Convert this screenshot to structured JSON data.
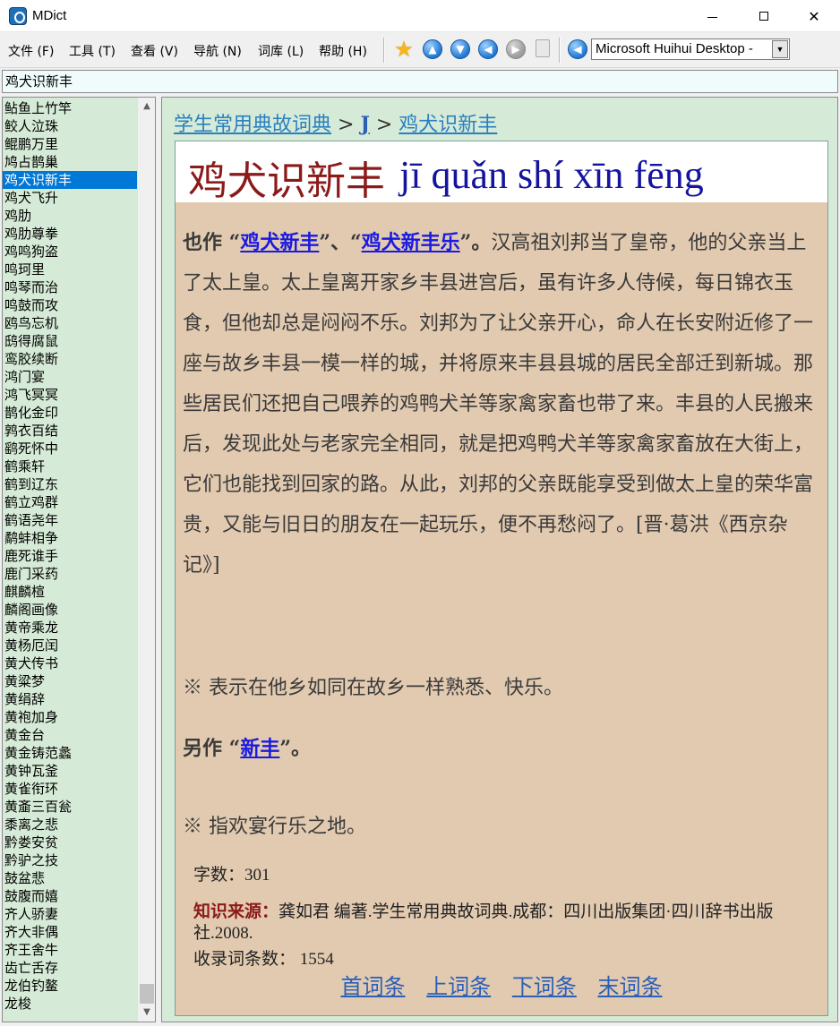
{
  "window": {
    "title": "MDict",
    "minimize_symbol": "",
    "close_symbol": "✕"
  },
  "menu": [
    {
      "label": "文件 (F)"
    },
    {
      "label": "工具 (T)"
    },
    {
      "label": "查看 (V)"
    },
    {
      "label": "导航 (N)"
    },
    {
      "label": "词库 (L)"
    },
    {
      "label": "帮助 (H)"
    }
  ],
  "toolbar": {
    "icons": [
      "star-icon",
      "arrow-up-icon",
      "arrow-down-icon",
      "arrow-left-icon",
      "arrow-right-icon",
      "clipboard-icon",
      "speaker-icon"
    ],
    "dictionary_selected": "Microsoft Huihui Desktop -"
  },
  "search": {
    "value": "鸡犬识新丰"
  },
  "wordlist": {
    "selected_index": 4,
    "items": [
      "鲇鱼上竹竿",
      "鲛人泣珠",
      "鲲鹏万里",
      "鸠占鹊巢",
      "鸡犬识新丰",
      "鸡犬飞升",
      "鸡肋",
      "鸡肋尊拳",
      "鸡鸣狗盗",
      "鸣珂里",
      "鸣琴而治",
      "鸣鼓而攻",
      "鸥鸟忘机",
      "鸱得腐鼠",
      "鸾胶续断",
      "鸿门宴",
      "鸿飞冥冥",
      "鹊化金印",
      "鹑衣百结",
      "鹞死怀中",
      "鹤乘轩",
      "鹤到辽东",
      "鹤立鸡群",
      "鹤语尧年",
      "鹬蚌相争",
      "鹿死谁手",
      "鹿门采药",
      "麒麟楦",
      "麟阁画像",
      "黄帝乘龙",
      "黄杨厄闰",
      "黄犬传书",
      "黄粱梦",
      "黄绢辞",
      "黄袍加身",
      "黄金台",
      "黄金铸范蠡",
      "黄钟瓦釜",
      "黄雀衔环",
      "黄齑三百瓮",
      "黍离之悲",
      "黔娄安贫",
      "黔驴之技",
      "鼓盆悲",
      "鼓腹而嬉",
      "齐人骄妻",
      "齐大非偶",
      "齐王舍牛",
      "齿亡舌存",
      "龙伯钓鳌",
      "龙梭"
    ]
  },
  "breadcrumb": {
    "dictionary": "学生常用典故词典",
    "sep1": " > ",
    "letter": "J",
    "sep2": " > ",
    "entry": "鸡犬识新丰"
  },
  "entry": {
    "headword": "鸡犬识新丰",
    "pinyin": "jī quǎn shí xīn fēng",
    "main_prefix": "也作 “",
    "variant1": "鸡犬新丰",
    "main_mid": "”、“",
    "variant2": "鸡犬新丰乐",
    "main_suffix": "”。",
    "main_text": "汉高祖刘邦当了皇帝，他的父亲当上了太上皇。太上皇离开家乡丰县进宫后，虽有许多人侍候，每日锦衣玉食，但他却总是闷闷不乐。刘邦为了让父亲开心，命人在长安附近修了一座与故乡丰县一模一样的城，并将原来丰县县城的居民全部迁到新城。那些居民们还把自己喂养的鸡鸭犬羊等家禽家畜也带了来。丰县的人民搬来后，发现此处与老家完全相同，就是把鸡鸭犬羊等家禽家畜放在大街上，它们也能找到回家的路。从此，刘邦的父亲既能享受到做太上皇的荣华富贵，又能与旧日的朋友在一起玩乐，便不再愁闷了。[晋·葛洪《西京杂记》]",
    "note1": "※ 表示在他乡如同在故乡一样熟悉、快乐。",
    "alt_prefix": "另作 “",
    "alt_variant": "新丰",
    "alt_suffix": "”。",
    "note2": "※ 指欢宴行乐之地。",
    "char_count": "字数：301",
    "source_label": "知识来源：",
    "source_text": "龚如君 编著.学生常用典故词典.成都：四川出版集团·四川辞书出版社.2008.",
    "total_entries": "收录词条数：  1554"
  },
  "nav": {
    "first": "首词条",
    "prev": "上词条",
    "next": "下词条",
    "last": "末词条"
  }
}
